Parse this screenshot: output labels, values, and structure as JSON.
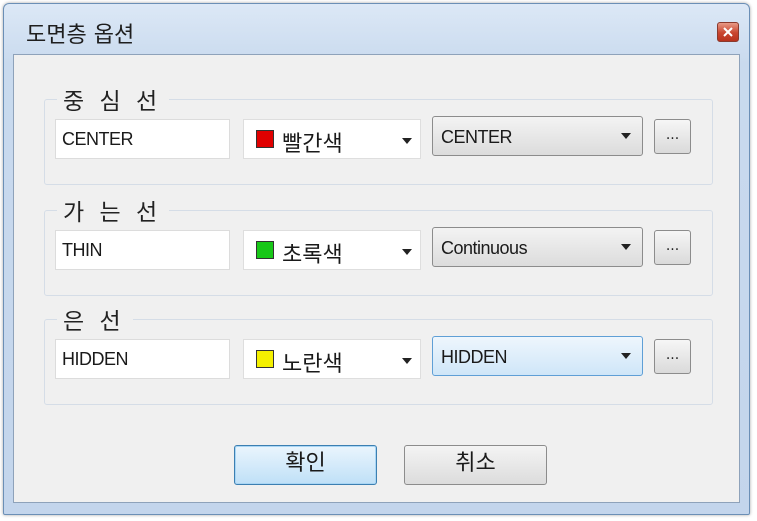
{
  "window": {
    "title": "도면층 옵션"
  },
  "layers": [
    {
      "group_label": "중 심 선",
      "name": "CENTER",
      "color_label": "빨간색",
      "color": "#e00000",
      "linetype": "CENTER",
      "more_label": "..."
    },
    {
      "group_label": "가 는 선",
      "name": "THIN",
      "color_label": "초록색",
      "color": "#18c818",
      "linetype": "Continuous",
      "more_label": "..."
    },
    {
      "group_label": "은 선",
      "name": "HIDDEN",
      "color_label": "노란색",
      "color": "#f4f000",
      "linetype": "HIDDEN",
      "more_label": "..."
    }
  ],
  "buttons": {
    "ok": "확인",
    "cancel": "취소"
  },
  "icons": {
    "close": "close-icon",
    "dropdown": "chevron-down-icon"
  }
}
